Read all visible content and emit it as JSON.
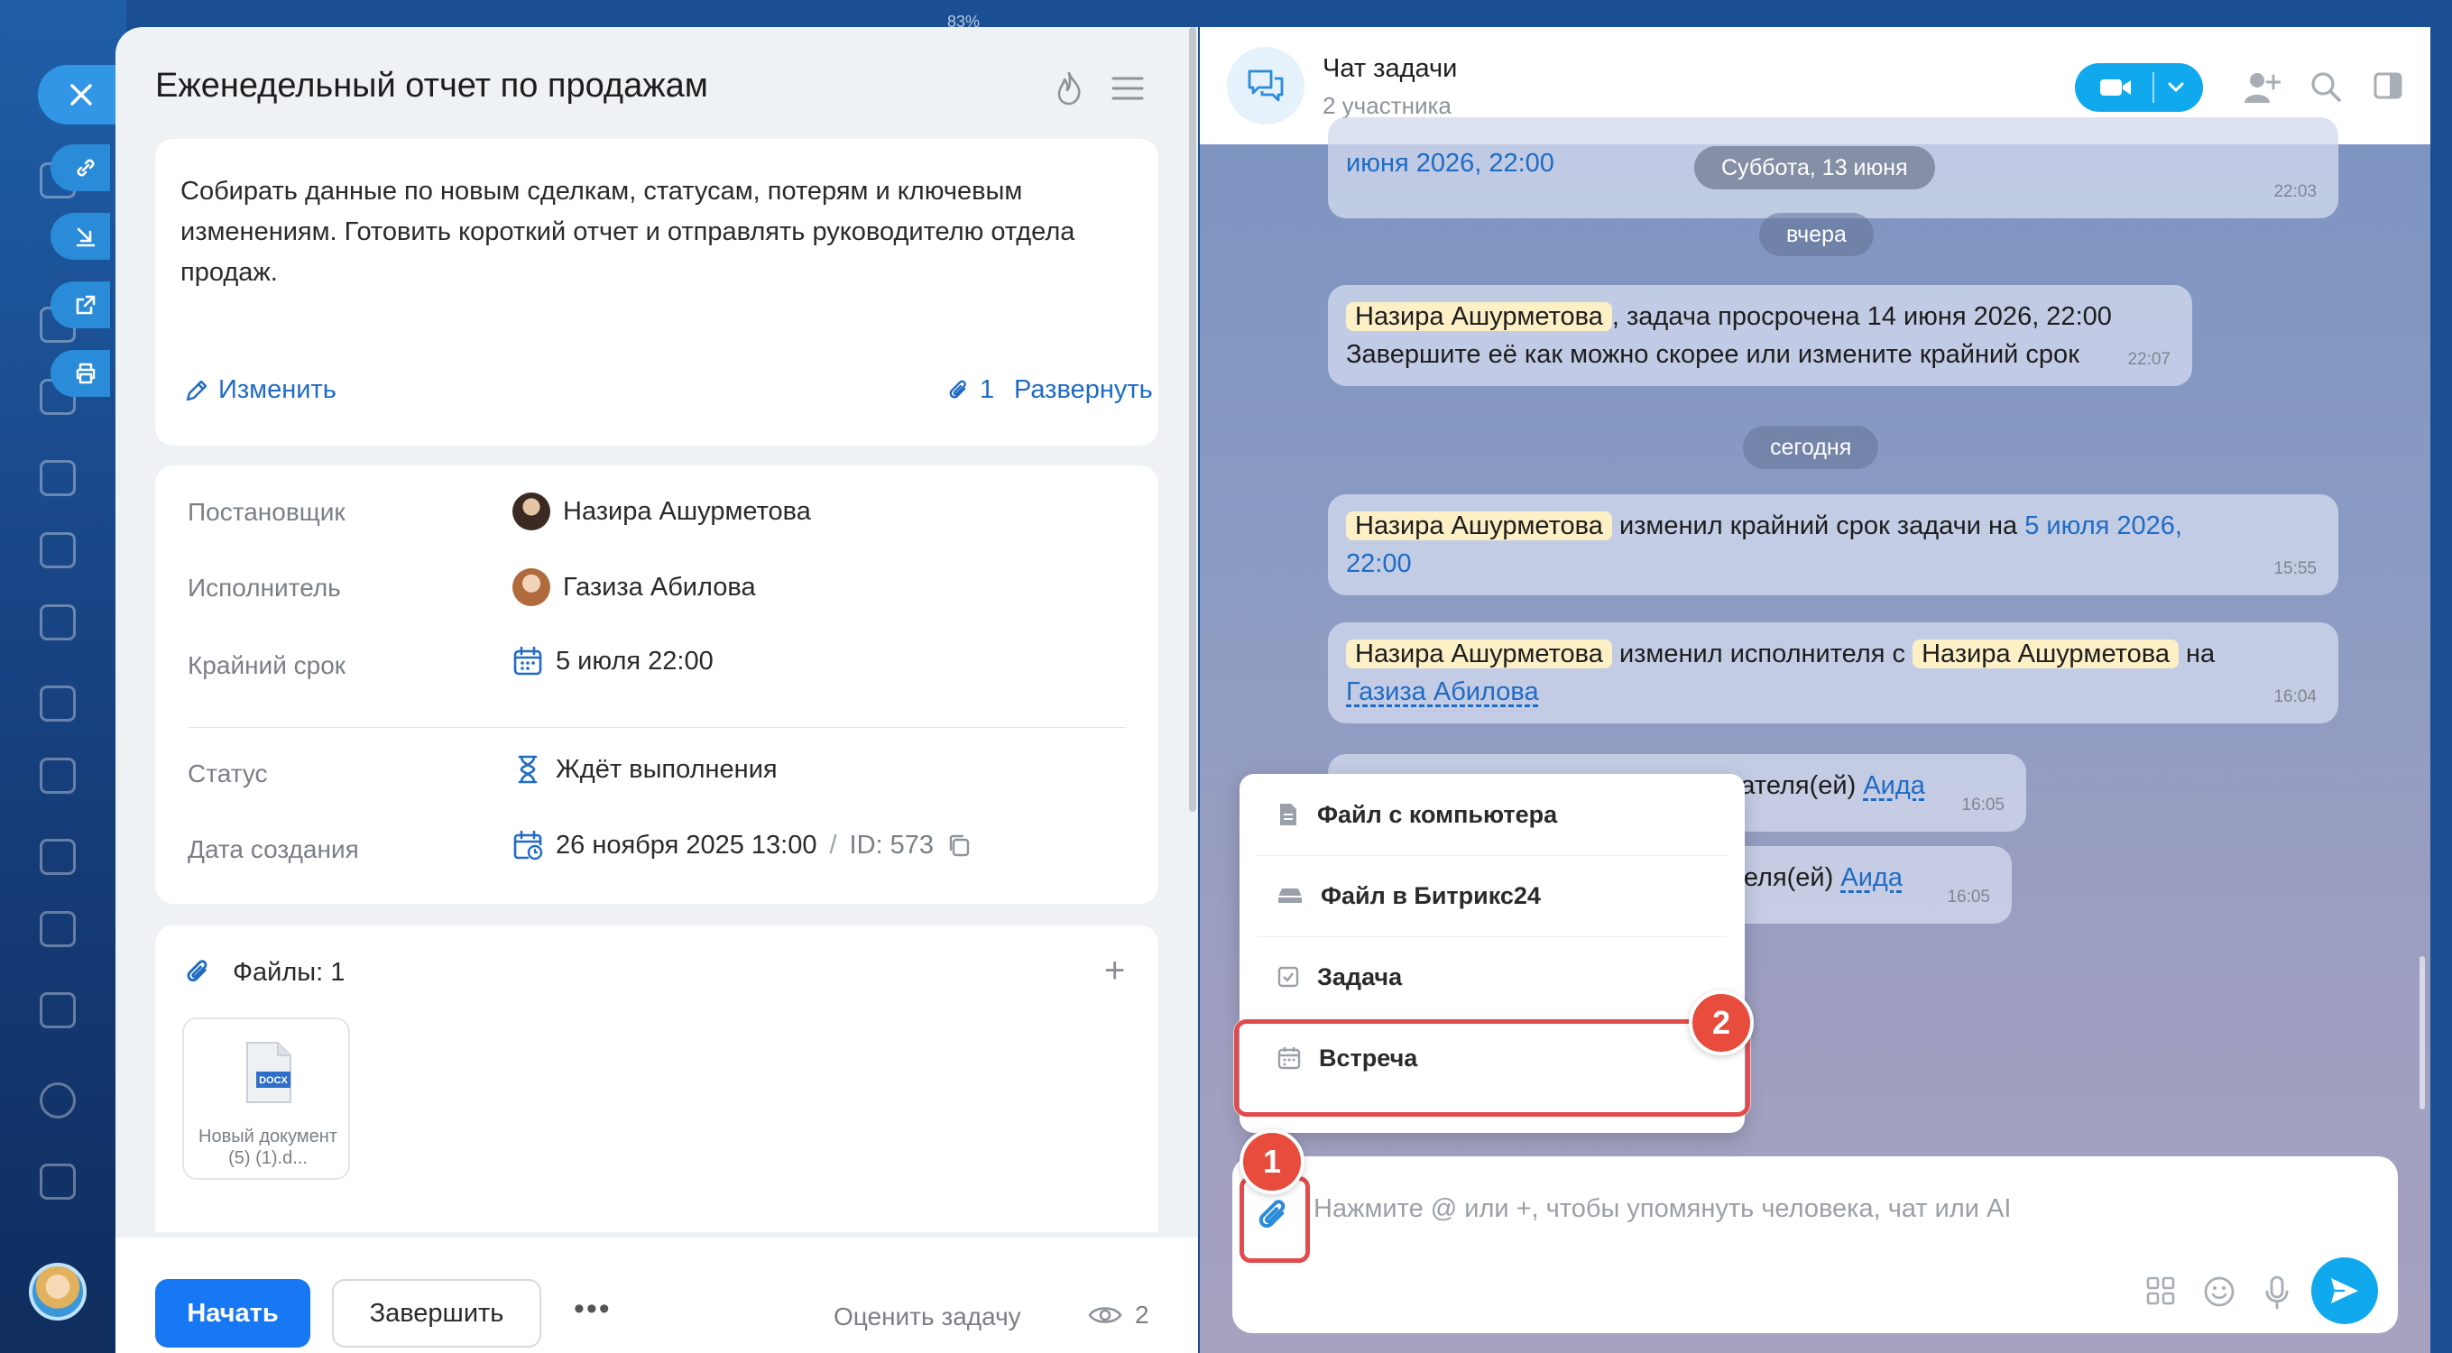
{
  "background": {
    "battery_text": "83%"
  },
  "task": {
    "title": "Еженедельный отчет по продажам",
    "description": "Собирать данные по новым сделкам, статусам, потерям и ключевым изменениям. Готовить короткий отчет и отправлять руководителю отдела продаж.",
    "edit_label": "Изменить",
    "attachments_count": "1",
    "expand_label": "Развернуть",
    "fields": {
      "creator_label": "Постановщик",
      "creator_value": "Назира Ашурметова",
      "assignee_label": "Исполнитель",
      "assignee_value": "Газиза Абилова",
      "deadline_label": "Крайний срок",
      "deadline_value": "5 июля 22:00",
      "status_label": "Статус",
      "status_value": "Ждёт выполнения",
      "created_label": "Дата создания",
      "created_value": "26 ноября 2025 13:00",
      "id_separator": "/",
      "id_value": "ID: 573"
    },
    "files": {
      "title": "Файлы: 1",
      "add_symbol": "+",
      "file_ext": "DOCX",
      "file_name": "Новый документ (5) (1).d..."
    },
    "actions": {
      "start": "Начать",
      "finish": "Завершить",
      "more": "•••",
      "rate": "Оценить задачу",
      "views": "2"
    }
  },
  "chat": {
    "title": "Чат задачи",
    "subtitle": "2 участника",
    "partial_top_text": "июня 2026, 22:00",
    "partial_top_time": "22:03",
    "days": [
      "Суббота, 13 июня",
      "вчера",
      "сегодня"
    ],
    "messages": [
      {
        "mention": "Назира Ашурметова",
        "text1": ", задача просрочена 14 июня 2026, 22:00",
        "text2": "Завершите её как можно скорее или измените крайний срок",
        "time": "22:07"
      },
      {
        "mention": "Назира Ашурметова",
        "text1": "изменил крайний срок задачи на",
        "link": "5 июля 2026,",
        "link2": "22:00",
        "time": "15:55"
      },
      {
        "mention": "Назира Ашурметова",
        "text1": "изменил исполнителя с",
        "mention2": "Назира Ашурметова",
        "text2": "на",
        "link": "Газиза Абилова",
        "time": "16:04"
      },
      {
        "text": "л наблюдателя(ей)",
        "link": "Аида Калиева",
        "time": "16:05"
      },
      {
        "text": "наблюдателя(ей)",
        "link": "Аида Калиева",
        "time": "16:05"
      }
    ],
    "attach_menu": {
      "items": [
        "Файл с компьютера",
        "Файл в Битрикс24",
        "Задача",
        "Встреча"
      ]
    },
    "input_placeholder": "Нажмите @ или +, чтобы упомянуть человека, чат или AI"
  },
  "annotations": {
    "step1": "1",
    "step2": "2"
  },
  "colors": {
    "accent": "#1877f2",
    "chat_accent": "#11a9ed",
    "highlight": "#e14b4b",
    "mention_bg": "#fdf0c7"
  }
}
